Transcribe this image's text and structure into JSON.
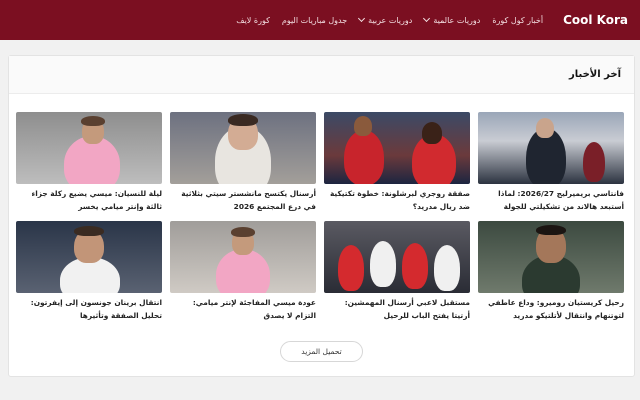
{
  "header": {
    "brand": "Cool Kora",
    "nav": [
      {
        "label": "أخبار كول كورة",
        "dropdown": false
      },
      {
        "label": "دوريات عالمية",
        "dropdown": true
      },
      {
        "label": "دوريات عربية",
        "dropdown": true
      },
      {
        "label": "جدول مباريات اليوم",
        "dropdown": false
      },
      {
        "label": "كورة لايف",
        "dropdown": false
      }
    ],
    "color": "#7b0f21"
  },
  "panel": {
    "title": "آخر الأخبار",
    "more_label": "تحميل المزيد"
  },
  "articles": [
    {
      "title": "فانتاسي بريميرليج 2026/27: لماذا أستبعد هالاند من تشكيلتي للجولة الأولى؟",
      "scene": "blue-stadium"
    },
    {
      "title": "صفقة روجري لبرشلونة: خطوة تكتيكية ضد ريال مدريد؟",
      "scene": "red-players"
    },
    {
      "title": "أرسنال يكتسح مانشستر سيتي بثلاثية في درع المجتمع 2026",
      "scene": "portrait-dark"
    },
    {
      "title": "ليلة للنسيان: ميسي يضيع ركلة جزاء ثالثة وإنتر ميامي يخسر",
      "scene": "pink-kit"
    },
    {
      "title": "رحيل كريستيان روميرو: وداع عاطفي لتوتنهام وانتقال لأتلتيكو مدريد",
      "scene": "portrait-green"
    },
    {
      "title": "مستقبل لاعبي أرسنال المهمشين: أرتيتا يفتح الباب للرحيل",
      "scene": "red-team"
    },
    {
      "title": "عودة ميسي المفاجئة لإنتر ميامي: التزام لا يصدق",
      "scene": "pink-kit2"
    },
    {
      "title": "انتقال برينان جونسون إلى إيفرتون: تحليل الصفقة وتأثيرها",
      "scene": "portrait-light"
    }
  ]
}
